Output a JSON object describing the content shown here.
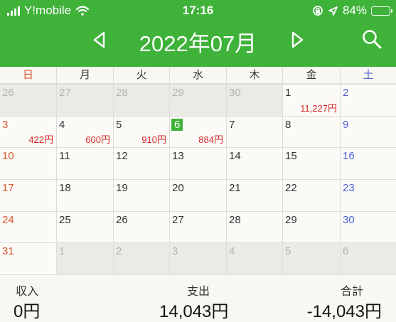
{
  "status": {
    "carrier": "Y!mobile",
    "time": "17:16",
    "battery": "84%",
    "battery_level": 0.84
  },
  "header": {
    "month": "2022年07月"
  },
  "weekdays": [
    "日",
    "月",
    "火",
    "水",
    "木",
    "金",
    "土"
  ],
  "calendar": [
    [
      {
        "day": "26",
        "other": true
      },
      {
        "day": "27",
        "other": true
      },
      {
        "day": "28",
        "other": true
      },
      {
        "day": "29",
        "other": true
      },
      {
        "day": "30",
        "other": true
      },
      {
        "day": "1",
        "amount": "11,227円"
      },
      {
        "day": "2"
      }
    ],
    [
      {
        "day": "3",
        "amount": "422円"
      },
      {
        "day": "4",
        "amount": "600円"
      },
      {
        "day": "5",
        "amount": "910円"
      },
      {
        "day": "6",
        "today": true,
        "amount": "884円"
      },
      {
        "day": "7"
      },
      {
        "day": "8"
      },
      {
        "day": "9"
      }
    ],
    [
      {
        "day": "10"
      },
      {
        "day": "11"
      },
      {
        "day": "12"
      },
      {
        "day": "13"
      },
      {
        "day": "14"
      },
      {
        "day": "15"
      },
      {
        "day": "16"
      }
    ],
    [
      {
        "day": "17"
      },
      {
        "day": "18"
      },
      {
        "day": "19"
      },
      {
        "day": "20"
      },
      {
        "day": "21"
      },
      {
        "day": "22"
      },
      {
        "day": "23"
      }
    ],
    [
      {
        "day": "24"
      },
      {
        "day": "25"
      },
      {
        "day": "26"
      },
      {
        "day": "27"
      },
      {
        "day": "28"
      },
      {
        "day": "29"
      },
      {
        "day": "30"
      }
    ],
    [
      {
        "day": "31"
      },
      {
        "day": "1",
        "other": true
      },
      {
        "day": "2",
        "other": true
      },
      {
        "day": "3",
        "other": true
      },
      {
        "day": "4",
        "other": true
      },
      {
        "day": "5",
        "other": true
      },
      {
        "day": "6",
        "other": true
      }
    ]
  ],
  "summary": {
    "income_label": "収入",
    "income_value": "0円",
    "expense_label": "支出",
    "expense_value": "14,043円",
    "total_label": "合計",
    "total_value": "-14,043円"
  },
  "colors": {
    "accent": "#3fb23a",
    "sunday": "#d65a2f",
    "saturday": "#4b63d8",
    "expense": "#d52a2a"
  },
  "icons": [
    "signal-icon",
    "wifi-icon",
    "screen-lock-icon",
    "location-arrow-icon",
    "battery-icon",
    "previous-month-icon",
    "next-month-icon",
    "search-icon"
  ]
}
